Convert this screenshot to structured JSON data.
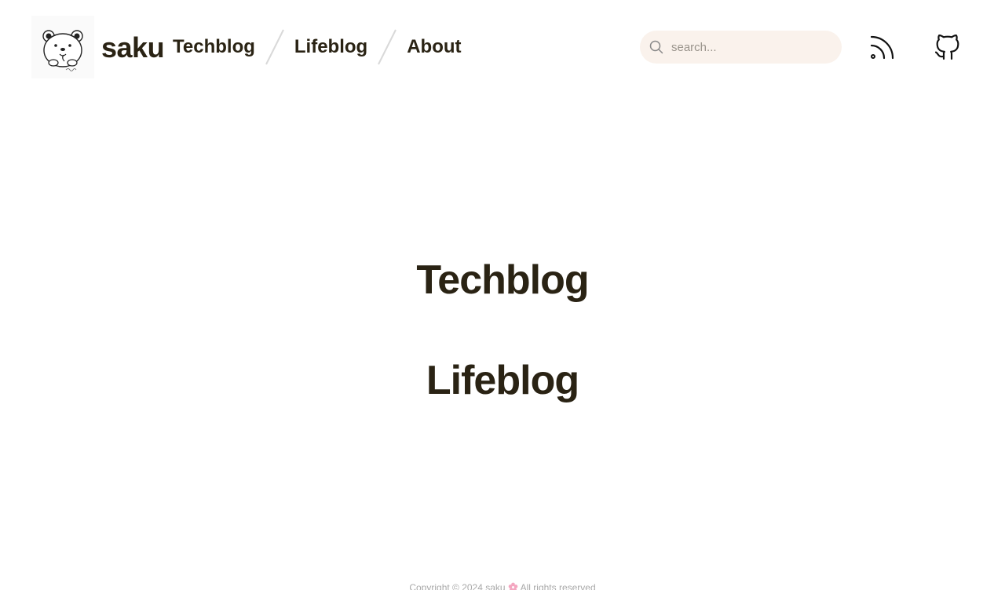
{
  "header": {
    "logo_alt": "saku bear avatar",
    "brand": "saku",
    "nav": [
      {
        "label": "Techblog"
      },
      {
        "label": "Lifeblog"
      },
      {
        "label": "About"
      }
    ],
    "search": {
      "placeholder": "search...",
      "value": "",
      "icon": "search-icon"
    },
    "icons": [
      "rss-icon",
      "github-icon"
    ]
  },
  "main": {
    "links": [
      {
        "label": "Techblog"
      },
      {
        "label": "Lifeblog"
      }
    ]
  },
  "footer": {
    "copyright": "Copyright © 2024 saku",
    "rights": "All rights reserved"
  },
  "colors": {
    "text": "#2a2314",
    "search_bg": "#faf2ec",
    "footer_text": "#a9a9a9",
    "flower": "#f4a6c0"
  }
}
